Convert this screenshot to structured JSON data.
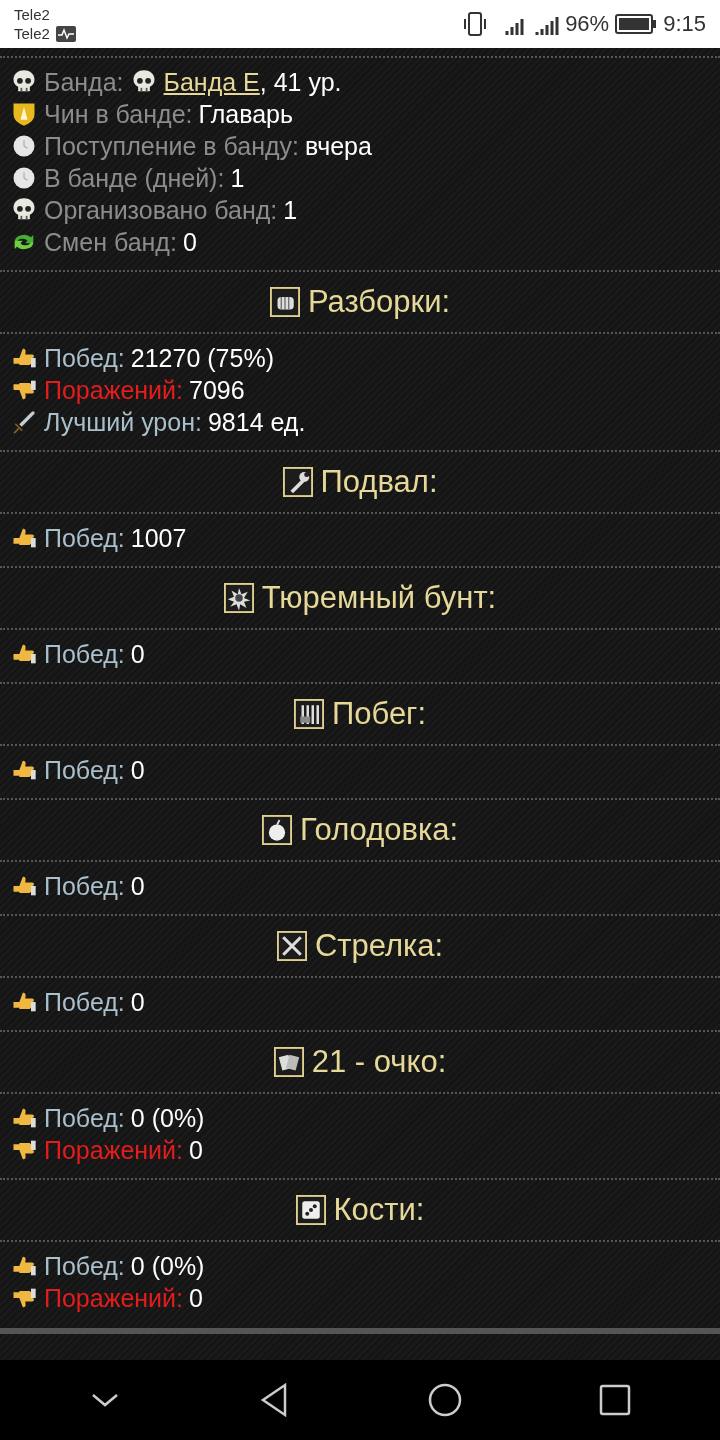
{
  "status_bar": {
    "carriers": [
      "Tele2",
      "Tele2"
    ],
    "battery": "96%",
    "time": "9:15"
  },
  "gang_info": [
    {
      "kind": "skull",
      "label": "Банда:",
      "link": "Банда Е",
      "value": ", 41 ур."
    },
    {
      "kind": "shield",
      "label": "Чин в банде:",
      "value": "Главарь"
    },
    {
      "kind": "clock",
      "label": "Поступление в банду:",
      "value": "вчера"
    },
    {
      "kind": "clock",
      "label": "В банде (дней):",
      "value": "1"
    },
    {
      "kind": "skull",
      "label": "Организовано банд:",
      "value": "1"
    },
    {
      "kind": "swap",
      "label": "Смен банд:",
      "value": "0"
    }
  ],
  "sections": [
    {
      "title": "Разборки:",
      "kind": "fist",
      "stats": [
        {
          "kind": "win",
          "label": "Побед:",
          "value": "21270 (75%)"
        },
        {
          "kind": "loss",
          "label": "Поражений:",
          "value": "7096"
        },
        {
          "kind": "damage",
          "label": "Лучший урон:",
          "value": "9814 ед."
        }
      ]
    },
    {
      "title": "Подвал:",
      "kind": "wrench",
      "stats": [
        {
          "kind": "win",
          "label": "Побед:",
          "value": "1007"
        }
      ]
    },
    {
      "title": "Тюремный бунт:",
      "kind": "burst",
      "stats": [
        {
          "kind": "win",
          "label": "Побед:",
          "value": "0"
        }
      ]
    },
    {
      "title": "Побег:",
      "kind": "bars",
      "stats": [
        {
          "kind": "win",
          "label": "Побед:",
          "value": "0"
        }
      ]
    },
    {
      "title": "Голодовка:",
      "kind": "apple",
      "stats": [
        {
          "kind": "win",
          "label": "Побед:",
          "value": "0"
        }
      ]
    },
    {
      "title": "Стрелка:",
      "kind": "cross",
      "stats": [
        {
          "kind": "win",
          "label": "Побед:",
          "value": "0"
        }
      ]
    },
    {
      "title": "21 - очко:",
      "kind": "cards",
      "stats": [
        {
          "kind": "win",
          "label": "Побед:",
          "value": "0 (0%)"
        },
        {
          "kind": "loss",
          "label": "Поражений:",
          "value": "0"
        }
      ]
    },
    {
      "title": "Кости:",
      "kind": "dice",
      "stats": [
        {
          "kind": "win",
          "label": "Побед:",
          "value": "0 (0%)"
        },
        {
          "kind": "loss",
          "label": "Поражений:",
          "value": "0"
        }
      ]
    }
  ]
}
